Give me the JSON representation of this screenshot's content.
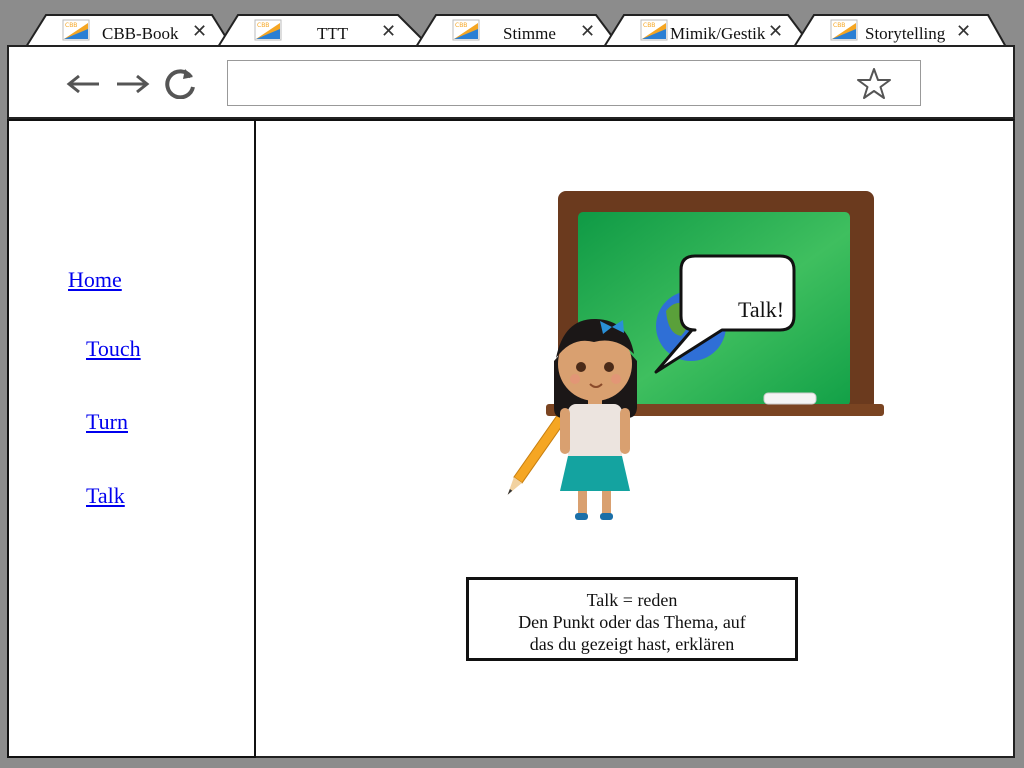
{
  "browser": {
    "tabs": [
      {
        "label": "CBB-Book",
        "close": "✕"
      },
      {
        "label": "TTT",
        "close": "✕"
      },
      {
        "label": "Stimme",
        "close": "✕"
      },
      {
        "label": "Mimik/Gestik",
        "close": "✕"
      },
      {
        "label": "Storytelling",
        "close": "✕"
      }
    ],
    "active_tab": "TTT",
    "url": ""
  },
  "sidebar": {
    "links": [
      {
        "label": "Home"
      },
      {
        "label": "Touch"
      },
      {
        "label": "Turn"
      },
      {
        "label": "Talk"
      }
    ]
  },
  "main": {
    "speech_bubble": "Talk!",
    "info_lines": [
      "Talk = reden",
      "Den Punkt oder das Thema, auf",
      "das du gezeigt hast, erklären"
    ]
  },
  "colors": {
    "link": "#0000ee",
    "board_frame": "#6b3a1e",
    "board_green": "#16a34a",
    "skirt": "#14a3a0"
  },
  "icons": [
    "back-arrow-icon",
    "forward-arrow-icon",
    "reload-icon",
    "bookmark-star-icon",
    "favicon-logo-icon",
    "close-icon"
  ]
}
